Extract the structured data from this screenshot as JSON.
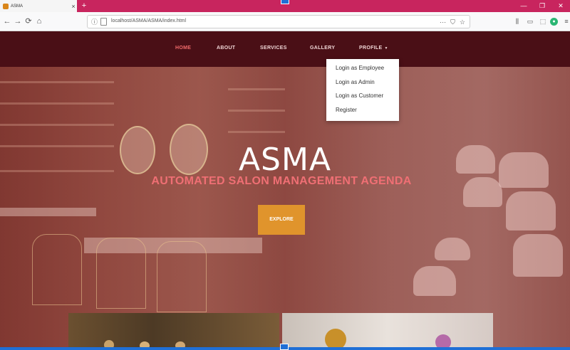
{
  "browser": {
    "tab_title": "ASMA",
    "tab_close": "×",
    "new_tab": "+",
    "window_buttons": [
      "—",
      "❐",
      "✕"
    ],
    "nav_icons": [
      "back-icon",
      "forward-icon",
      "reload-icon",
      "home-icon"
    ],
    "url": "localhost/ASMA/ASMA/index.html",
    "url_actions": [
      "···",
      "⛉",
      "☆"
    ],
    "toolbar_icons": [
      "library-icon",
      "sidebar-icon",
      "screenshot-icon",
      "extension-icon",
      "menu-icon"
    ]
  },
  "site": {
    "nav": {
      "home": "HOME",
      "about": "ABOUT",
      "services": "SERVICES",
      "gallery": "GALLERY",
      "profile": "PROFILE",
      "caret": "▼"
    },
    "profile_menu": [
      "Login as Employee",
      "Login as Admin",
      "Login as Customer",
      "Register"
    ],
    "hero": {
      "title": "ASMA",
      "subtitle": "AUTOMATED SALON MANAGEMENT AGENDA",
      "button": "EXPLORE"
    }
  },
  "colors": {
    "tab_strip": "#c8255e",
    "navbar": "#4a0f16",
    "nav_active": "#f06a6a",
    "subtitle": "#ef6f74",
    "explore_button": "#e0942c"
  }
}
